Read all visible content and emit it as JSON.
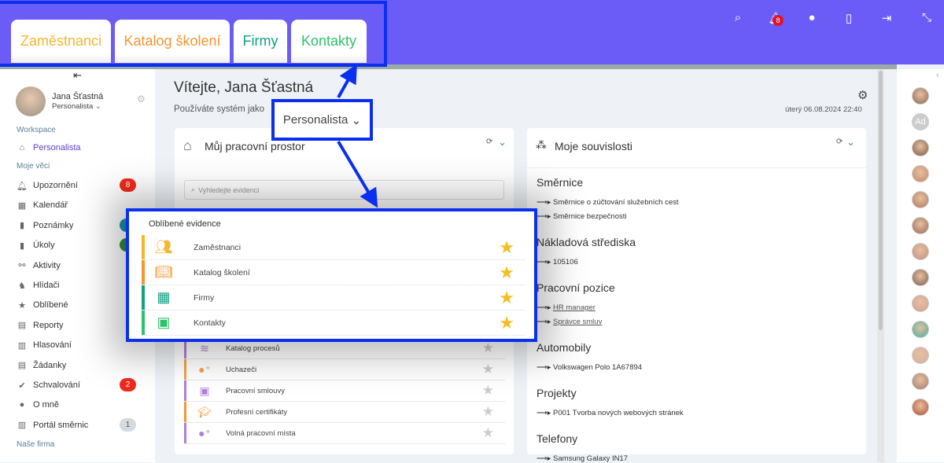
{
  "header": {
    "tabs": [
      {
        "label": "Zaměstnanci",
        "color": "#f5b731"
      },
      {
        "label": "Katalog školení",
        "color": "#f5962f"
      },
      {
        "label": "Firmy",
        "color": "#14a085"
      },
      {
        "label": "Kontakty",
        "color": "#2dc26b"
      }
    ],
    "icons": [
      "search-icon",
      "bell-icon",
      "chat-icon",
      "mobile-icon",
      "sign-in-icon",
      "compress-icon"
    ],
    "notification_count": "8",
    "brand_color": "#6c5cf7",
    "highlight_color": "#0a2ff0"
  },
  "sidebar": {
    "user_name": "Jana Šťastná",
    "user_role": "Personalista",
    "workspace_label": "Workspace",
    "workspace_item": "Personalista",
    "my_things_label": "Moje věci",
    "items": [
      {
        "label": "Upozornění",
        "icon": "bell-icon",
        "badge": "8",
        "badge_color": "#f02a1e"
      },
      {
        "label": "Kalendář",
        "icon": "calendar-icon"
      },
      {
        "label": "Poznámky",
        "icon": "clipboard-icon",
        "badge_color": "#1e8fa8"
      },
      {
        "label": "Úkoly",
        "icon": "task-icon",
        "badge_color": "#2f8a3c"
      },
      {
        "label": "Aktivity",
        "icon": "activity-icon"
      },
      {
        "label": "Hlídači",
        "icon": "dog-icon"
      },
      {
        "label": "Oblíbené",
        "icon": "star-icon"
      },
      {
        "label": "Reporty",
        "icon": "report-icon"
      },
      {
        "label": "Hlasování",
        "icon": "vote-icon"
      },
      {
        "label": "Žádanky",
        "icon": "request-icon"
      },
      {
        "label": "Schvalování",
        "icon": "check-circle-icon",
        "badge": "2",
        "badge_color": "#f02a1e"
      },
      {
        "label": "O mně",
        "icon": "user-icon"
      },
      {
        "label": "Portál směrnic",
        "icon": "directive-icon",
        "badge": "1",
        "badge_color": "#d4dbe0"
      }
    ],
    "our_company_label": "Naše firma"
  },
  "main": {
    "welcome": "Vítejte, Jana Šťastná",
    "using_as": "Používáte systém jako",
    "role_dropdown": "Personalista",
    "datetime": "úterý 06.08.2024 22:40"
  },
  "workspace": {
    "title": "Můj pracovní prostor",
    "search_placeholder": "Vyhledejte evidenci",
    "rows": [
      {
        "label": "Katalog procesů",
        "color": "#b07fd6",
        "icon": "process-icon"
      },
      {
        "label": "Uchazeči",
        "color": "#f0a24a",
        "icon": "user-plus-icon"
      },
      {
        "label": "Pracovní smlouvy",
        "color": "#b07fd6",
        "icon": "id-card-icon"
      },
      {
        "label": "Profesní certifikáty",
        "color": "#f5962f",
        "icon": "graduate-icon"
      },
      {
        "label": "Volná pracovní místa",
        "color": "#b07fd6",
        "icon": "user-plus-icon"
      }
    ]
  },
  "favorites": {
    "title": "Oblíbené evidence",
    "rows": [
      {
        "label": "Zaměstnanci",
        "color": "#f5b731",
        "icon": "users-icon"
      },
      {
        "label": "Katalog školení",
        "color": "#f5962f",
        "icon": "book-reader-icon"
      },
      {
        "label": "Firmy",
        "color": "#14a085",
        "icon": "building-icon"
      },
      {
        "label": "Kontakty",
        "color": "#2dc26b",
        "icon": "contact-card-icon"
      }
    ]
  },
  "relations": {
    "title": "Moje souvislosti",
    "sections": [
      {
        "heading": "Směrnice",
        "items": [
          {
            "text": "Směrnice o zúčtování služebních cest"
          },
          {
            "text": "Směrnice bezpečnosti"
          }
        ]
      },
      {
        "heading": "Nákladová střediska",
        "items": [
          {
            "text": "105106"
          }
        ]
      },
      {
        "heading": "Pracovní pozice",
        "items": [
          {
            "text": "HR manager",
            "link": true
          },
          {
            "text": "Správce smluv",
            "link": true
          }
        ]
      },
      {
        "heading": "Automobily",
        "items": [
          {
            "text": "Volkswagen Polo 1A67894"
          }
        ]
      },
      {
        "heading": "Projekty",
        "items": [
          {
            "text": "P001 Tvorba nových webových stránek"
          }
        ]
      },
      {
        "heading": "Telefony",
        "items": [
          {
            "text": "Samsung Galaxy IN17"
          }
        ]
      }
    ]
  },
  "people": {
    "initials_avatar": "Ad"
  }
}
